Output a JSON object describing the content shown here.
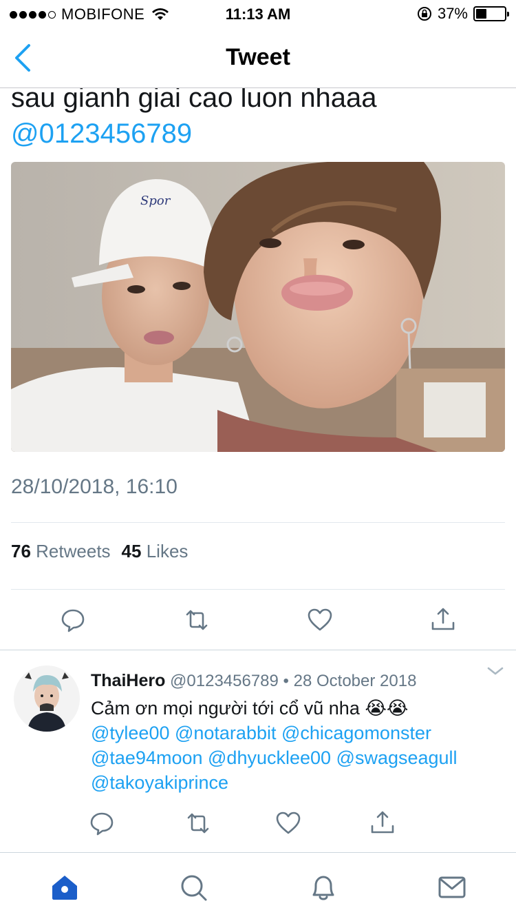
{
  "status_bar": {
    "carrier": "MOBIFONE",
    "time": "11:13 AM",
    "battery": "37%",
    "battery_level": 0.37,
    "signal_bars_filled": 4,
    "signal_bars_total": 5
  },
  "nav": {
    "title": "Tweet",
    "back_icon": "chevron-left-icon"
  },
  "tweet": {
    "text_line": "sau gianh giai cao luon nhaaa",
    "mention": "@0123456789",
    "timestamp": "28/10/2018, 16:10",
    "retweets_count": "76",
    "retweets_label": "Retweets",
    "likes_count": "45",
    "likes_label": "Likes",
    "actions": [
      "reply-icon",
      "retweet-icon",
      "like-icon",
      "share-icon"
    ]
  },
  "reply": {
    "name": "ThaiHero",
    "handle": "@0123456789",
    "separator": "•",
    "date": "28 October 2018",
    "text": "Cảm ơn mọi người tới cổ vũ nha 😭😭",
    "mentions_line1": "@tylee00 @notarabbit @chicagomonster",
    "mentions_line2": "@tae94moon @dhyucklee00 @swagseagull",
    "mentions_line3": "@takoyakiprince",
    "actions": [
      "reply-icon",
      "retweet-icon",
      "like-icon",
      "share-icon"
    ]
  },
  "tab_bar": {
    "tabs": [
      "home-icon",
      "search-icon",
      "notifications-icon",
      "messages-icon"
    ],
    "active": "home-icon"
  },
  "colors": {
    "accent": "#1da1f2",
    "text": "#14171a",
    "secondary": "#657786",
    "tab_active": "#1b5ec9",
    "tab_inactive": "#657786"
  }
}
